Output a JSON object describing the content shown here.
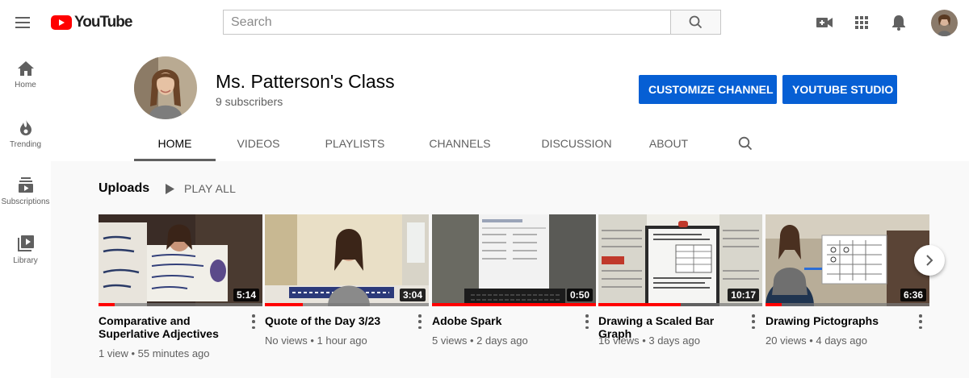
{
  "topbar": {
    "logo_text": "YouTube",
    "search_placeholder": "Search",
    "icons": [
      "menu-icon",
      "video-camera-add-icon",
      "apps-grid-icon",
      "bell-icon",
      "search-icon"
    ],
    "brand_red": "#ff0000"
  },
  "sidebar": {
    "items": [
      {
        "label": "Home",
        "icon": "home-icon"
      },
      {
        "label": "Trending",
        "icon": "flame-icon"
      },
      {
        "label": "Subscriptions",
        "icon": "subscriptions-icon"
      },
      {
        "label": "Library",
        "icon": "library-icon"
      }
    ]
  },
  "channel": {
    "name": "Ms. Patterson's Class",
    "subscribers": "9 subscribers",
    "customize_label": "CUSTOMIZE CHANNEL",
    "studio_label": "YOUTUBE STUDIO",
    "accent_color": "#065fd4",
    "tabs": [
      {
        "label": "HOME",
        "active": true
      },
      {
        "label": "VIDEOS",
        "active": false
      },
      {
        "label": "PLAYLISTS",
        "active": false
      },
      {
        "label": "CHANNELS",
        "active": false
      },
      {
        "label": "DISCUSSION",
        "active": false
      },
      {
        "label": "ABOUT",
        "active": false
      }
    ]
  },
  "uploads": {
    "title": "Uploads",
    "play_all_label": "PLAY ALL",
    "videos": [
      {
        "title": "Comparative and Superlative Adjectives",
        "meta": "1 view • 55 minutes ago",
        "duration": "5:14",
        "watched": 0.1
      },
      {
        "title": "Quote of the Day 3/23",
        "meta": "No views • 1 hour ago",
        "duration": "3:04",
        "watched": 0.23
      },
      {
        "title": "Adobe Spark",
        "meta": "5 views • 2 days ago",
        "duration": "0:50",
        "watched": 1.0
      },
      {
        "title": "Drawing a Scaled Bar Graph",
        "meta": "16 views • 3 days ago",
        "duration": "10:17",
        "watched": 0.5
      },
      {
        "title": "Drawing Pictographs",
        "meta": "20 views • 4 days ago",
        "duration": "6:36",
        "watched": 0.1
      }
    ]
  }
}
